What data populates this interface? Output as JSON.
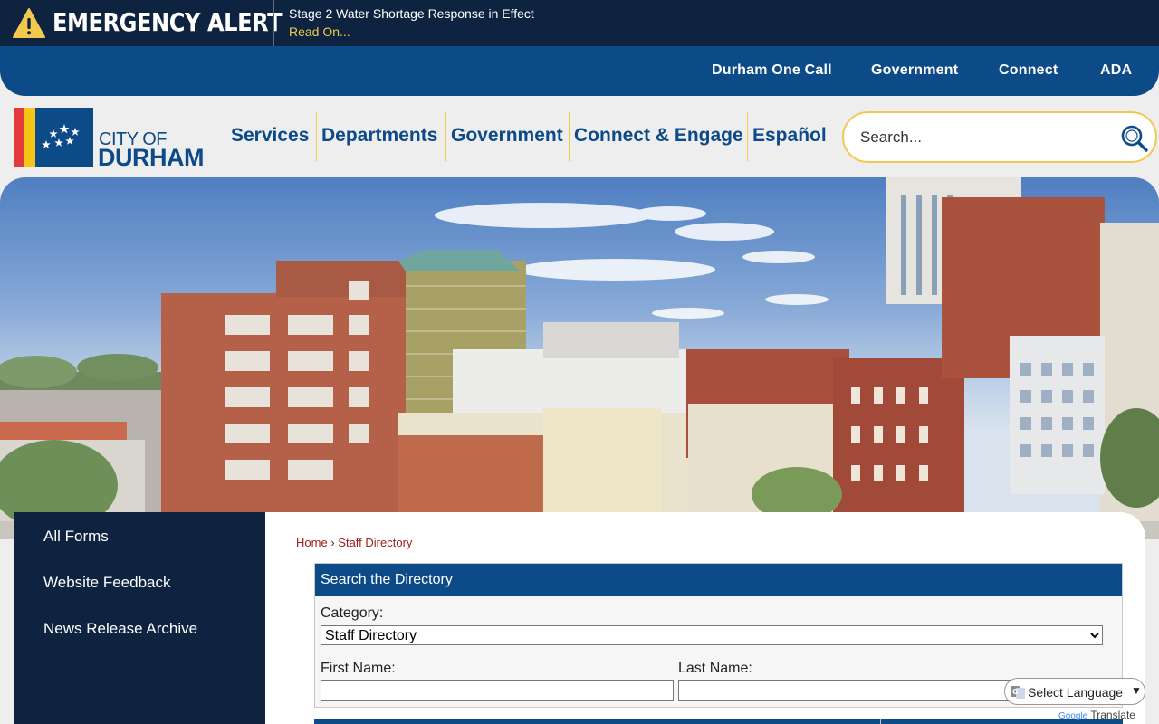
{
  "alert": {
    "title": "EMERGENCY ALERT",
    "message": "Stage 2 Water Shortage Response in Effect",
    "link": "Read On..."
  },
  "utility_nav": [
    "Durham One Call",
    "Government",
    "Connect",
    "ADA"
  ],
  "logo": {
    "line1": "CITY OF",
    "line2": "DURHAM"
  },
  "main_nav": [
    "Services",
    "Departments",
    "Government",
    "Connect & Engage",
    "Español"
  ],
  "search": {
    "placeholder": "Search..."
  },
  "sidebar": [
    "All Forms",
    "Website Feedback",
    "News Release Archive"
  ],
  "breadcrumb": {
    "home": "Home",
    "separator": "›",
    "current": "Staff Directory"
  },
  "directory": {
    "header": "Search the Directory",
    "category_label": "Category:",
    "category_value": "Staff Directory",
    "first_name_label": "First Name:",
    "last_name_label": "Last Name:"
  },
  "translate": {
    "label": "Select Language",
    "powered_by": "Google",
    "powered_text": "Translate"
  },
  "colors": {
    "navy": "#0d2340",
    "blue": "#0d4a88",
    "gold": "#f2c94c",
    "red": "#e03a3e"
  }
}
